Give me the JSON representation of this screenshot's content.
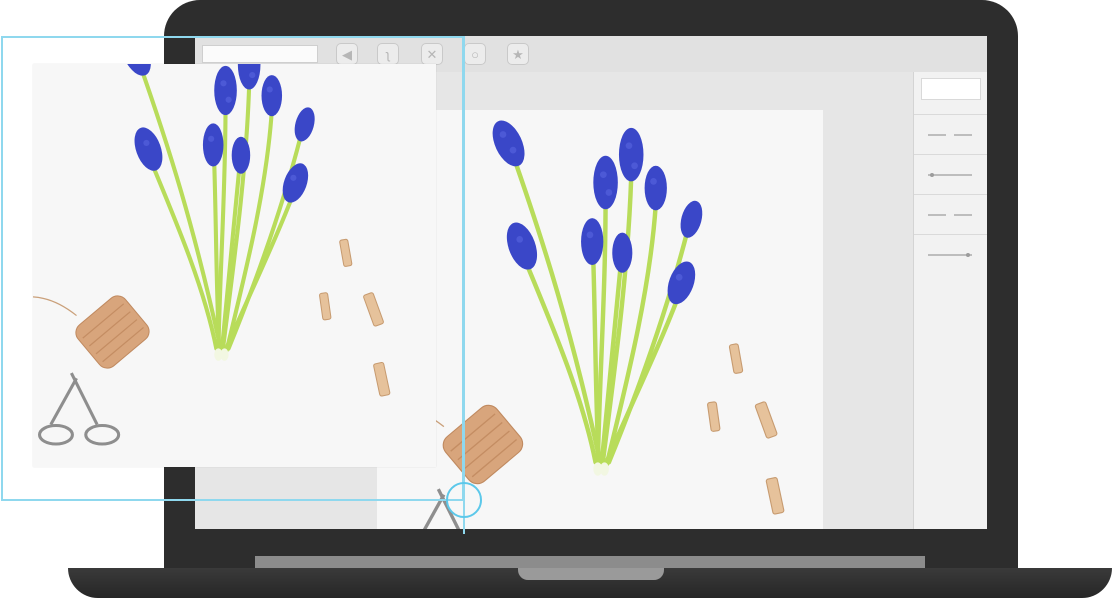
{
  "window": {
    "toolbar": {
      "search_field": {
        "value": ""
      },
      "tools": [
        {
          "name": "pointer-tool",
          "icon": "arrow-pointer-icon",
          "glyph": "◀"
        },
        {
          "name": "lasso-tool",
          "icon": "lasso-icon",
          "glyph": "ʅ"
        },
        {
          "name": "erase-tool",
          "icon": "x-icon",
          "glyph": "✕"
        },
        {
          "name": "ellipse-tool",
          "icon": "circle-icon",
          "glyph": "○"
        },
        {
          "name": "favorite-tool",
          "icon": "star-icon",
          "glyph": "★"
        }
      ]
    },
    "right_panel": {
      "rows": [
        {
          "kind": "dashes"
        },
        {
          "kind": "slider",
          "value": 0.1
        },
        {
          "kind": "dashes"
        },
        {
          "kind": "slider",
          "value": 0.9
        }
      ]
    }
  },
  "colors": {
    "laptop": "#2d2d2d",
    "accent_cyan": "#8fd8ee",
    "flower_blue": "#3a47c8",
    "stem_green": "#b8dc5a",
    "twine": "#d8a57c",
    "clothespin": "#e6c29b"
  }
}
